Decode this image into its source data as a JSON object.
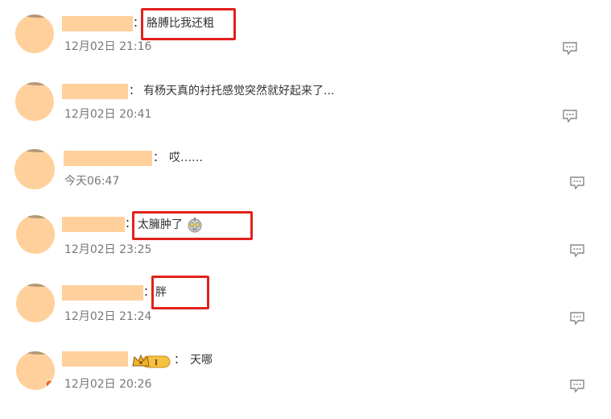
{
  "comments": [
    {
      "text": "胳膊比我还粗",
      "time": "12月02日 21:16",
      "highlighted": true
    },
    {
      "text": "有杨天真的衬托感觉突然就好起来了...",
      "time": "12月02日 20:41",
      "highlighted": false
    },
    {
      "text": "哎……",
      "time": "今天06:47",
      "highlighted": false
    },
    {
      "text": "太臃肿了",
      "time": "12月02日 23:25",
      "highlighted": true,
      "emoji": "robot-face"
    },
    {
      "text": "胖",
      "time": "12月02日 21:24",
      "highlighted": true
    },
    {
      "text": "天哪",
      "time": "12月02日 20:26",
      "highlighted": false,
      "vip_badge": "crown-level-badge",
      "vip_level": "I"
    }
  ],
  "colon": "：",
  "colors": {
    "avatar_placeholder": "#FFD09B",
    "highlight_box": "#e3211c",
    "time_text": "#777777",
    "comment_text": "#333333"
  },
  "icons": {
    "reply": "comment-bubble-icon"
  }
}
